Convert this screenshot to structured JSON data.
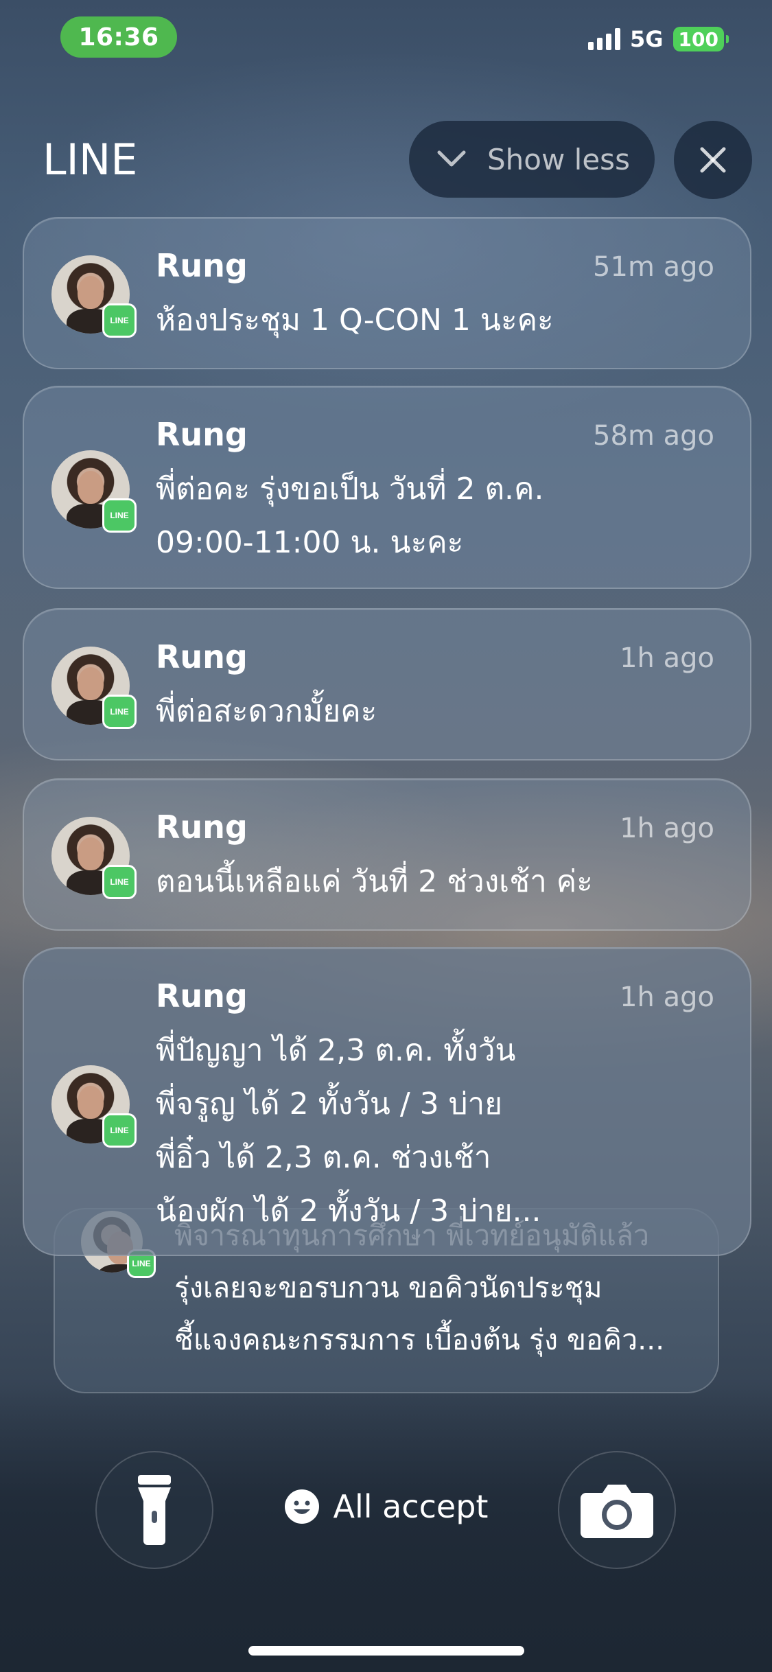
{
  "status_bar": {
    "time": "16:36",
    "network": "5G",
    "battery": "100"
  },
  "header": {
    "app_name": "LINE",
    "show_less_label": "Show less"
  },
  "notifications": [
    {
      "sender": "Rung",
      "time": "51m ago",
      "message": "ห้องประชุม 1 Q-CON 1 นะคะ"
    },
    {
      "sender": "Rung",
      "time": "58m ago",
      "message": "พี่ต่อคะ รุ่งขอเป็น วันที่ 2 ต.ค.\n09:00-11:00 น. นะคะ"
    },
    {
      "sender": "Rung",
      "time": "1h ago",
      "message": "พี่ต่อสะดวกมั้ยคะ"
    },
    {
      "sender": "Rung",
      "time": "1h ago",
      "message": "ตอนนี้เหลือแค่ วันที่ 2 ช่วงเช้า ค่ะ"
    },
    {
      "sender": "Rung",
      "time": "1h ago",
      "message": "พี่ปัญญา ได้ 2,3 ต.ค. ทั้งวัน\nพี่จรูญ ได้ 2 ทั้งวัน / 3 บ่าย\nพี่อิ๋ว ได้ 2,3 ต.ค. ช่วงเช้า\nน้องผัก ได้ 2 ทั้งวัน / 3 บ่าย..."
    }
  ],
  "stacked_notification": {
    "message": "พิจารณาทุนการศึกษา พี่เวทย์อนุมัติแล้ว\nรุ่งเลยจะขอรบกวน ขอคิวนัดประชุม\nชี้แจงคณะกรรมการ เบื้องต้น รุ่ง ขอคิว..."
  },
  "bottom": {
    "accept_label": "All accept"
  },
  "icons": {
    "line_badge_text": "LINE",
    "badge_color": "#4cc764",
    "time_pill_color": "#4fb84f"
  }
}
